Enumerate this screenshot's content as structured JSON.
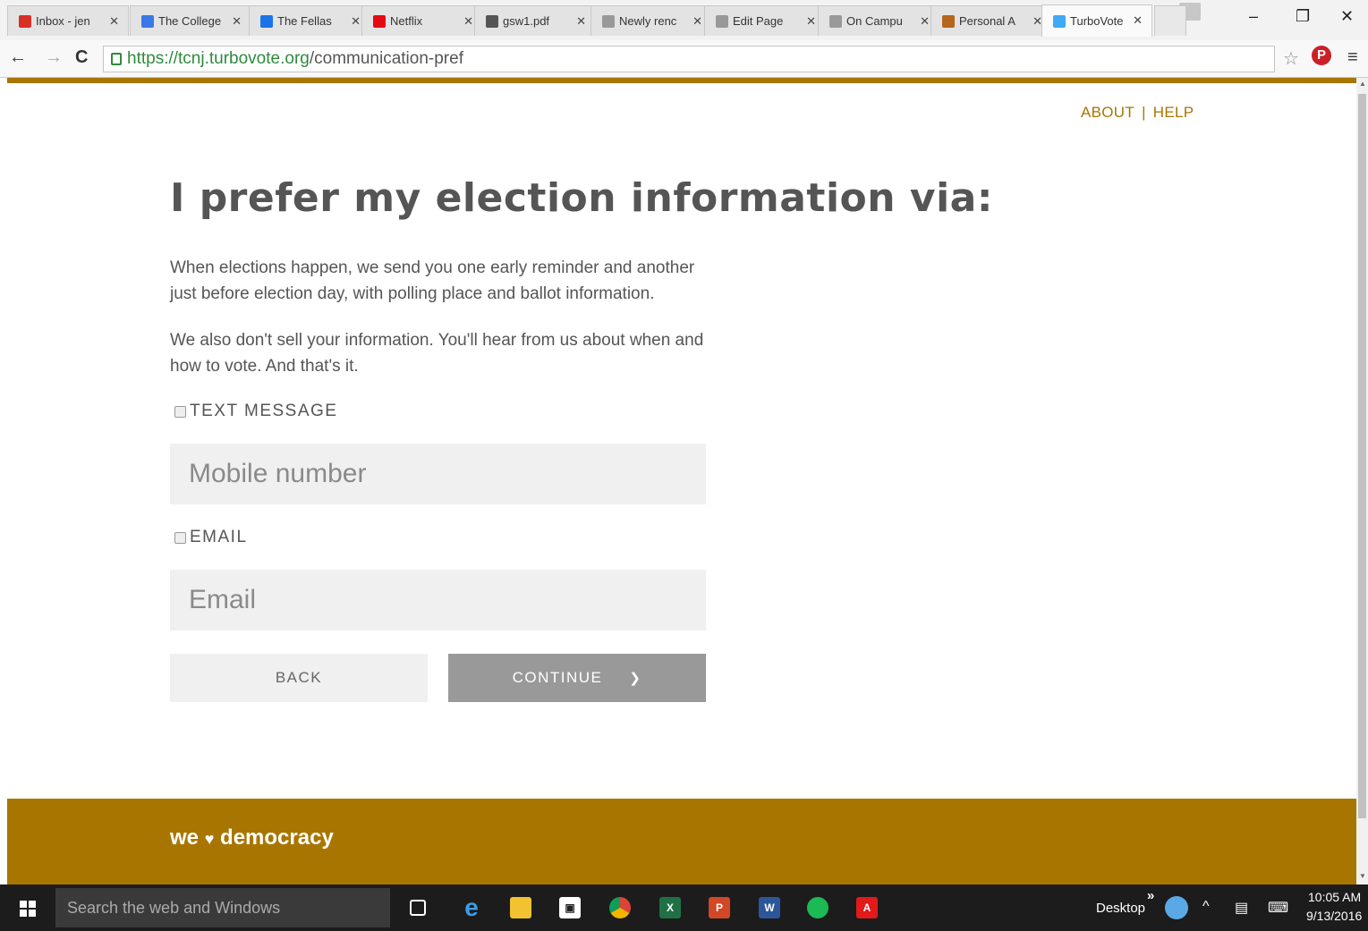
{
  "browser": {
    "tabs": [
      {
        "title": "Inbox - jen",
        "icon": "gmail-icon",
        "color": "#d93025"
      },
      {
        "title": "The College",
        "icon": "calendar-icon",
        "color": "#3b78e7"
      },
      {
        "title": "The Fellas",
        "icon": "circle-icon",
        "color": "#1a73e8"
      },
      {
        "title": "Netflix",
        "icon": "netflix-icon",
        "color": "#e50914"
      },
      {
        "title": "gsw1.pdf",
        "icon": "sheet-icon",
        "color": "#555555"
      },
      {
        "title": "Newly renc",
        "icon": "page-icon",
        "color": "#999999"
      },
      {
        "title": "Edit Page",
        "icon": "page-icon",
        "color": "#999999"
      },
      {
        "title": "On Campu",
        "icon": "page-icon",
        "color": "#999999"
      },
      {
        "title": "Personal A",
        "icon": "bookmark-icon",
        "color": "#b5651d"
      },
      {
        "title": "TurboVote",
        "icon": "heart-icon",
        "color": "#3fa9f5"
      }
    ],
    "url_host": "https://tcnj.turbovote.org",
    "url_path": "/communication-pref"
  },
  "nav": {
    "about": "ABOUT",
    "separator": "|",
    "help": "HELP"
  },
  "page": {
    "headline": "I prefer my election information via:",
    "para1": "When elections happen, we send you one early reminder and another just before election day, with polling place and ballot information.",
    "para2": "We also don't sell your information. You'll hear from us about when and how to vote. And that's it.",
    "text_option": {
      "label": "TEXT MESSAGE",
      "checked": false
    },
    "mobile_placeholder": "Mobile number",
    "email_option": {
      "label": "EMAIL",
      "checked": false
    },
    "email_placeholder": "Email",
    "back_label": "BACK",
    "continue_label": "CONTINUE"
  },
  "footer": {
    "brand_before": "we",
    "brand_heart": "♥",
    "brand_after": "democracy"
  },
  "taskbar": {
    "search_placeholder": "Search the web and Windows",
    "desktop_label": "Desktop",
    "chevron": "»",
    "time": "10:05 AM",
    "date": "9/13/2016"
  },
  "colors": {
    "accent": "#a87600",
    "text": "#555555",
    "button_primary": "#999999",
    "field_bg": "#f0f0f1"
  }
}
